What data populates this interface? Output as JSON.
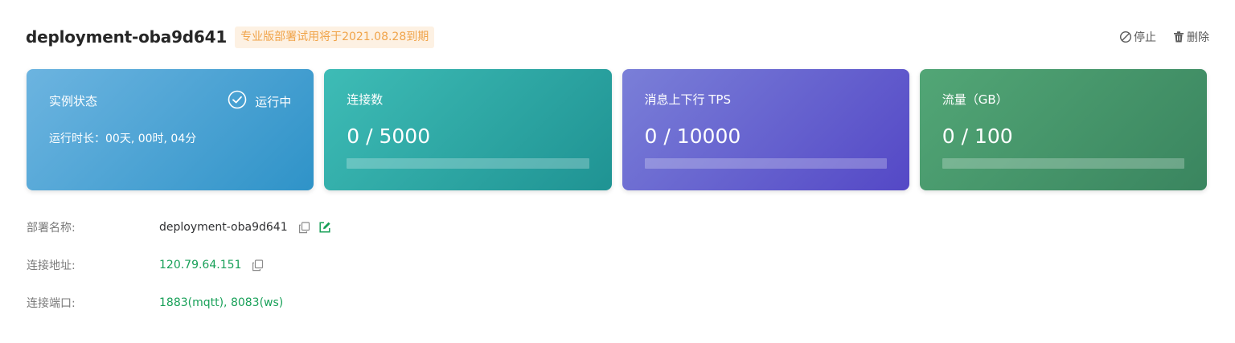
{
  "header": {
    "title": "deployment-oba9d641",
    "trial_badge": "专业版部署试用将于2021.08.28到期",
    "stop_label": "停止",
    "delete_label": "删除"
  },
  "cards": {
    "status": {
      "label": "实例状态",
      "state": "运行中",
      "uptime": "运行时长：00天, 00时, 04分"
    },
    "connections": {
      "label": "连接数",
      "value": "0 / 5000",
      "progress": 0
    },
    "tps": {
      "label": "消息上下行 TPS",
      "value": "0 / 10000",
      "progress": 0
    },
    "traffic": {
      "label": "流量（GB）",
      "value": "0 / 100",
      "progress": 0
    }
  },
  "info": {
    "name_label": "部署名称:",
    "name_value": "deployment-oba9d641",
    "address_label": "连接地址:",
    "address_value": "120.79.64.151",
    "port_label": "连接端口:",
    "port_value": "1883(mqtt), 8083(ws)"
  },
  "icons": {
    "stop": "ban-icon",
    "delete": "trash-icon",
    "status": "check-circle-icon",
    "copy": "copy-icon",
    "edit": "edit-icon"
  },
  "colors": {
    "accent_green": "#18a058",
    "badge_bg": "#fdf1e3",
    "badge_text": "#f0a44a"
  }
}
